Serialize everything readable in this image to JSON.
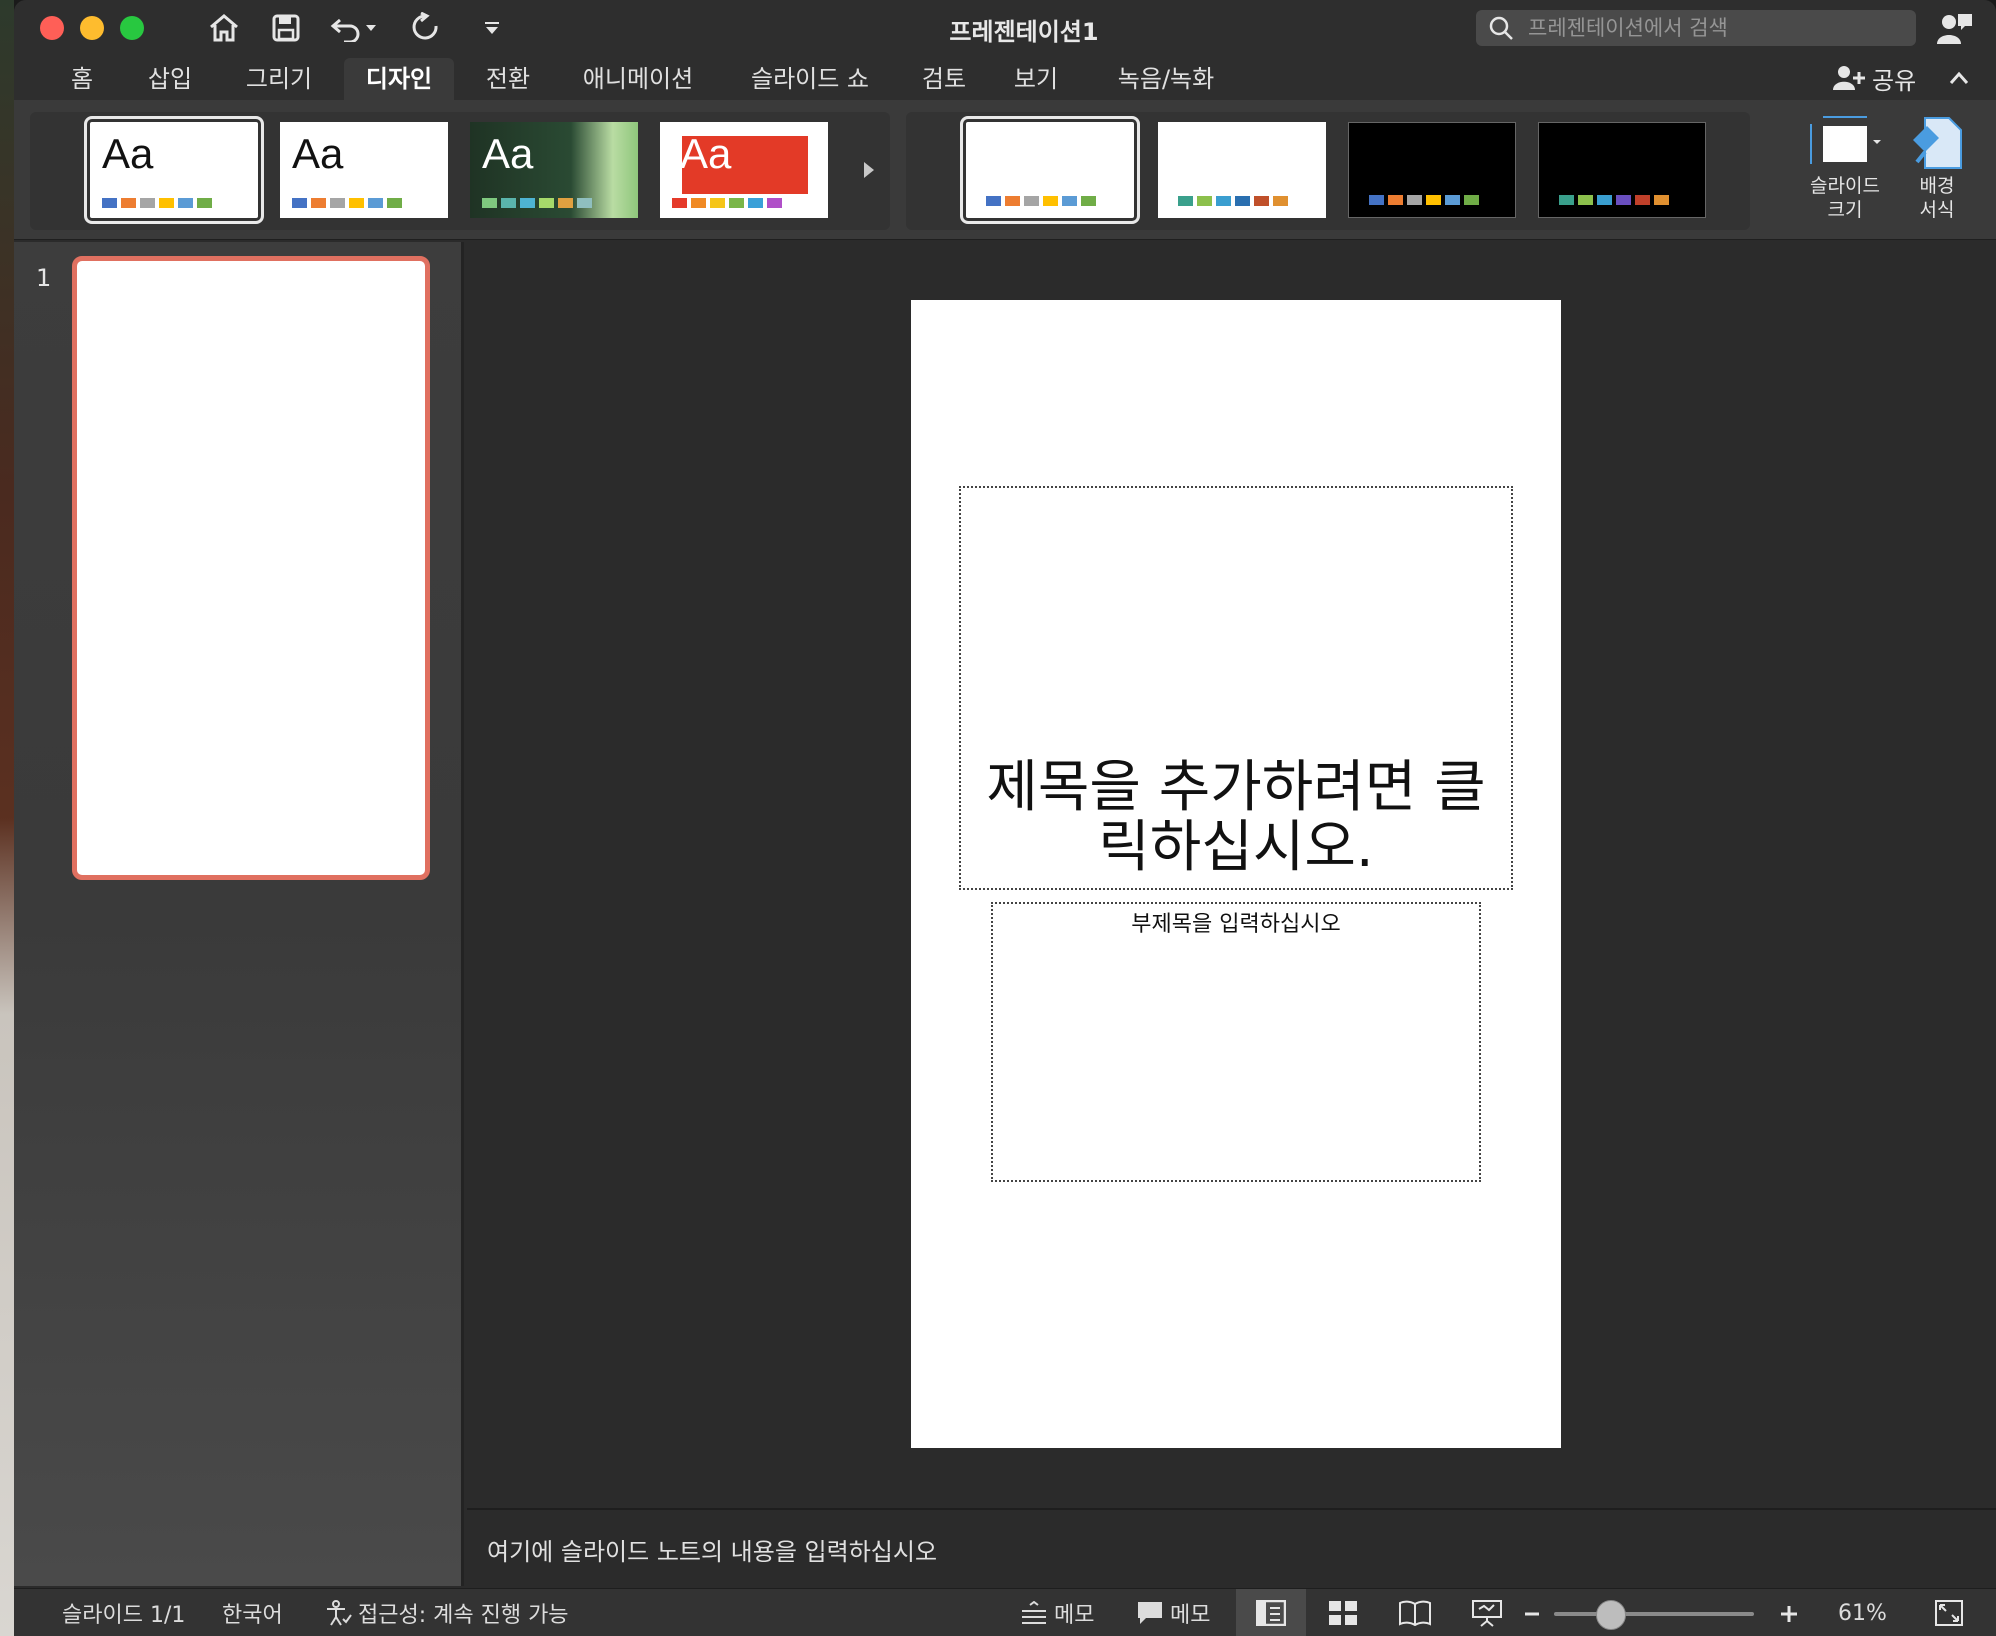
{
  "window": {
    "doc_title": "프레젠테이션1",
    "search_placeholder": "프레젠테이션에서 검색"
  },
  "tabs": [
    {
      "label": "홈"
    },
    {
      "label": "삽입"
    },
    {
      "label": "그리기"
    },
    {
      "label": "디자인",
      "active": true
    },
    {
      "label": "전환"
    },
    {
      "label": "애니메이션"
    },
    {
      "label": "슬라이드 쇼"
    },
    {
      "label": "검토"
    },
    {
      "label": "보기"
    },
    {
      "label": "녹음/녹화"
    }
  ],
  "share_label": "공유",
  "themes": [
    {
      "label": "Aa",
      "selected": true,
      "swatches": [
        "#4472c4",
        "#ed7d31",
        "#a5a5a5",
        "#ffc000",
        "#5b9bd5",
        "#70ad47"
      ]
    },
    {
      "label": "Aa",
      "swatches": [
        "#4472c4",
        "#ed7d31",
        "#a5a5a5",
        "#ffc000",
        "#5b9bd5",
        "#70ad47"
      ]
    },
    {
      "label": "Aa",
      "swatches": [
        "#7fc97f",
        "#5ab4ac",
        "#4eb3d3",
        "#a6d96a",
        "#e0a040",
        "#8fbfbf"
      ]
    },
    {
      "label": "Aa",
      "swatches": [
        "#e53a2a",
        "#f08a24",
        "#f5c518",
        "#7ab648",
        "#3aa0d8",
        "#b04fc8"
      ]
    }
  ],
  "variants": [
    {
      "selected": true,
      "bg": "#ffffff",
      "swatches": [
        "#4472c4",
        "#ed7d31",
        "#a5a5a5",
        "#ffc000",
        "#5b9bd5",
        "#70ad47"
      ]
    },
    {
      "bg": "#ffffff",
      "swatches": [
        "#3aa08c",
        "#8cc04c",
        "#3a9ed0",
        "#2a6fb0",
        "#c0502a",
        "#e09030"
      ]
    },
    {
      "bg": "#000000",
      "swatches": [
        "#4472c4",
        "#ed7d31",
        "#a5a5a5",
        "#ffc000",
        "#5b9bd5",
        "#70ad47"
      ]
    },
    {
      "bg": "#000000",
      "swatches": [
        "#3aa08c",
        "#8cc04c",
        "#3a9ed0",
        "#6a4fc0",
        "#c0402a",
        "#e09030"
      ]
    }
  ],
  "ribbon_buttons": {
    "slide_size": [
      "슬라이드",
      "크기"
    ],
    "format_background": [
      "배경",
      "서식"
    ]
  },
  "slide_panel": {
    "slide_number": "1"
  },
  "slide": {
    "title_placeholder_line1": "제목을 추가하려면 클",
    "title_placeholder_line2": "릭하십시오.",
    "subtitle_placeholder": "부제목을 입력하십시오"
  },
  "notes_placeholder": "여기에 슬라이드 노트의 내용을 입력하십시오",
  "status": {
    "slide_counter": "슬라이드 1/1",
    "language": "한국어",
    "accessibility": "접근성: 계속 진행 가능",
    "notes_label": "메모",
    "comments_label": "메모",
    "zoom_percent": "61%",
    "zoom_level": 0.61
  },
  "colors": {
    "accent_selection": "#e07060"
  }
}
